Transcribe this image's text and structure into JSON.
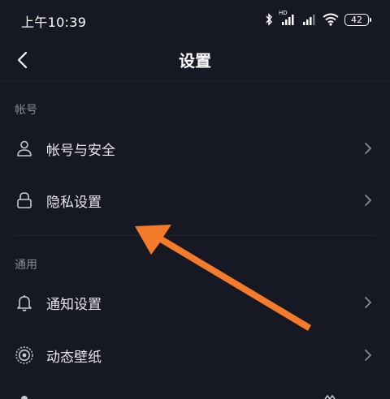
{
  "status_bar": {
    "time": "上午10:39",
    "battery": "42",
    "network_badge": "HD"
  },
  "header": {
    "title": "设置"
  },
  "sections": [
    {
      "title": "帐号",
      "items": [
        {
          "label": "帐号与安全",
          "icon": "person-icon"
        },
        {
          "label": "隐私设置",
          "icon": "lock-icon"
        }
      ]
    },
    {
      "title": "通用",
      "items": [
        {
          "label": "通知设置",
          "icon": "bell-icon"
        },
        {
          "label": "动态壁纸",
          "icon": "wallpaper-icon"
        }
      ]
    }
  ],
  "colors": {
    "background": "#161823",
    "text": "#e8e8ec",
    "section_header": "#8a8b93",
    "annotation_arrow": "#f47b2a"
  }
}
